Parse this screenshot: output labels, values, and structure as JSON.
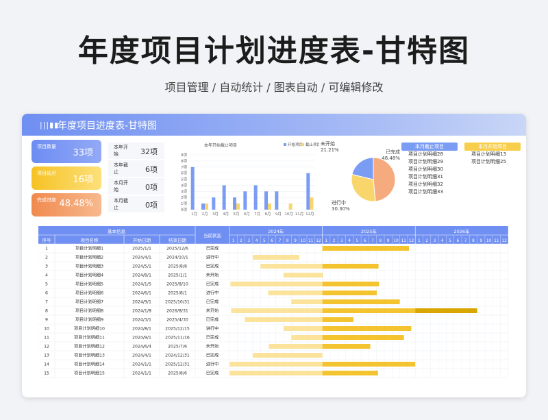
{
  "page": {
    "title": "年度项目计划进度表-甘特图",
    "subtitle": "项目管理 / 自动统计 / 图表自动 / 可编辑修改"
  },
  "card": {
    "title": "年度项目进度表-甘特图"
  },
  "kpis": [
    {
      "label": "项目数量",
      "value": "33项",
      "color": "#6d8df3"
    },
    {
      "label": "项目延迟",
      "value": "16项",
      "color": "#f6c224"
    },
    {
      "label": "完成进度",
      "value": "48.48%",
      "color": "#f08a4e"
    }
  ],
  "stats": [
    {
      "label": "本年开始",
      "value": "32项"
    },
    {
      "label": "本年截止",
      "value": "6项"
    },
    {
      "label": "本月开始",
      "value": "0项"
    },
    {
      "label": "本月截止",
      "value": "0项"
    }
  ],
  "chart_data": [
    {
      "type": "bar",
      "title": "本年开始截止项目",
      "categories": [
        "1月",
        "2月",
        "3月",
        "4月",
        "5月",
        "6月",
        "7月",
        "8月",
        "9月",
        "10月",
        "11月",
        "12月"
      ],
      "yticks": [
        "0项",
        "1项",
        "2项",
        "3项",
        "4项",
        "5项",
        "6项",
        "7项",
        "8项",
        "9项"
      ],
      "ylim": [
        0,
        9
      ],
      "legend_position": "top-right",
      "series": [
        {
          "name": "开始项目",
          "color": "#7b9cf3",
          "values": [
            7,
            1,
            2,
            4,
            2,
            3,
            4,
            3,
            3,
            0,
            0,
            6
          ]
        },
        {
          "name": "截止项目",
          "color": "#f8d66c",
          "values": [
            0,
            1,
            0,
            0,
            1,
            0,
            0,
            1,
            0,
            1,
            0,
            2
          ]
        }
      ]
    },
    {
      "type": "pie",
      "labels": [
        "已完成",
        "进行中",
        "未开始"
      ],
      "values": [
        48.48,
        30.3,
        21.21
      ],
      "display": [
        "48.48%",
        "30.30%",
        "21.21%"
      ],
      "colors": [
        "#f5ab7d",
        "#f8d66c",
        "#7b9cf3"
      ]
    }
  ],
  "month_end": {
    "title": "本月截止项目",
    "items": [
      "项目计划明细28",
      "项目计划明细29",
      "项目计划明细30",
      "项目计划明细31",
      "项目计划明细32",
      "项目计划明细33"
    ]
  },
  "month_start": {
    "title": "本月开始项目",
    "items": [
      "项目计划明细13",
      "项目计划明细25"
    ]
  },
  "gantt": {
    "group_header": "基本信息",
    "columns": [
      "序号",
      "项目名称",
      "开始日期",
      "结束日期",
      "当前状态"
    ],
    "years": [
      "2024年",
      "2025年",
      "2026年"
    ],
    "months": [
      "1",
      "2",
      "3",
      "4",
      "5",
      "6",
      "7",
      "8",
      "9",
      "10",
      "11",
      "12"
    ],
    "rows": [
      {
        "no": "1",
        "name": "项目计划明细1",
        "start": "2025/1/1",
        "end": "2025/12/6",
        "status": "已完成"
      },
      {
        "no": "2",
        "name": "项目计划明细2",
        "start": "2024/4/1",
        "end": "2024/10/1",
        "status": "进行中"
      },
      {
        "no": "3",
        "name": "项目计划明细3",
        "start": "2024/5/1",
        "end": "2025/8/8",
        "status": "已完成"
      },
      {
        "no": "4",
        "name": "项目计划明细4",
        "start": "2024/8/1",
        "end": "2025/1/1",
        "status": "未开始"
      },
      {
        "no": "5",
        "name": "项目计划明细5",
        "start": "2024/1/5",
        "end": "2025/8/10",
        "status": "已完成"
      },
      {
        "no": "6",
        "name": "项目计划明细6",
        "start": "2024/6/1",
        "end": "2025/8/1",
        "status": "进行中"
      },
      {
        "no": "7",
        "name": "项目计划明细7",
        "start": "2024/9/1",
        "end": "2025/10/31",
        "status": "已完成"
      },
      {
        "no": "8",
        "name": "项目计划明细8",
        "start": "2024/1/8",
        "end": "2026/8/31",
        "status": "未开始"
      },
      {
        "no": "9",
        "name": "项目计划明细9",
        "start": "2024/3/1",
        "end": "2025/4/30",
        "status": "已完成"
      },
      {
        "no": "10",
        "name": "项目计划明细10",
        "start": "2024/8/1",
        "end": "2025/12/15",
        "status": "进行中"
      },
      {
        "no": "11",
        "name": "项目计划明细11",
        "start": "2024/9/1",
        "end": "2025/11/16",
        "status": "已完成"
      },
      {
        "no": "12",
        "name": "项目计划明细12",
        "start": "2024/6/4",
        "end": "2025/7/6",
        "status": "未开始"
      },
      {
        "no": "13",
        "name": "项目计划明细13",
        "start": "2024/4/1",
        "end": "2024/12/31",
        "status": "已完成"
      },
      {
        "no": "14",
        "name": "项目计划明细14",
        "start": "2024/1/1",
        "end": "2025/12/31",
        "status": "进行中"
      },
      {
        "no": "15",
        "name": "项目计划明细15",
        "start": "2024/1/1",
        "end": "2025/8/6",
        "status": "已完成"
      }
    ],
    "colors": {
      "header": "#6f8ff2",
      "bar_light": "#fbe39b",
      "bar_dark": "#f4c430",
      "bar_deep": "#d9a600"
    }
  }
}
